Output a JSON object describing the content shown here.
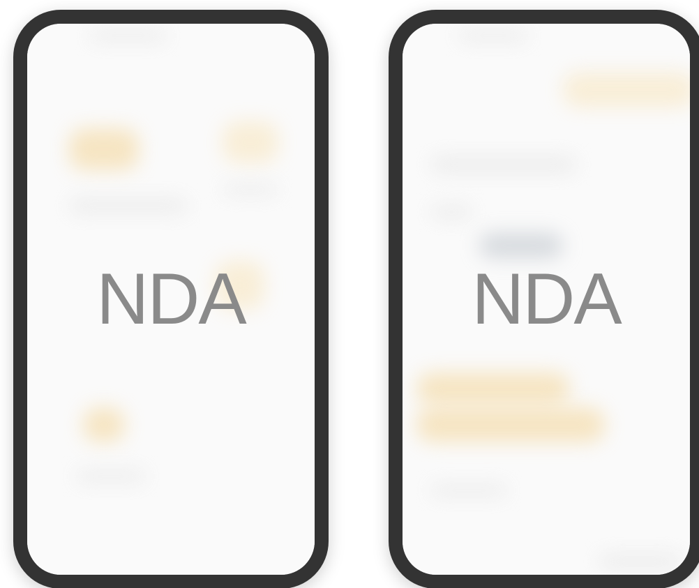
{
  "phones": [
    {
      "overlay_text": "NDA"
    },
    {
      "overlay_text": "NDA"
    }
  ],
  "colors": {
    "frame": "#333333",
    "screen": "#fafafa",
    "overlay_text": "#8a8a8a",
    "accent_blur": "#f5deb0",
    "slate_blur": "#b9c0c8"
  }
}
